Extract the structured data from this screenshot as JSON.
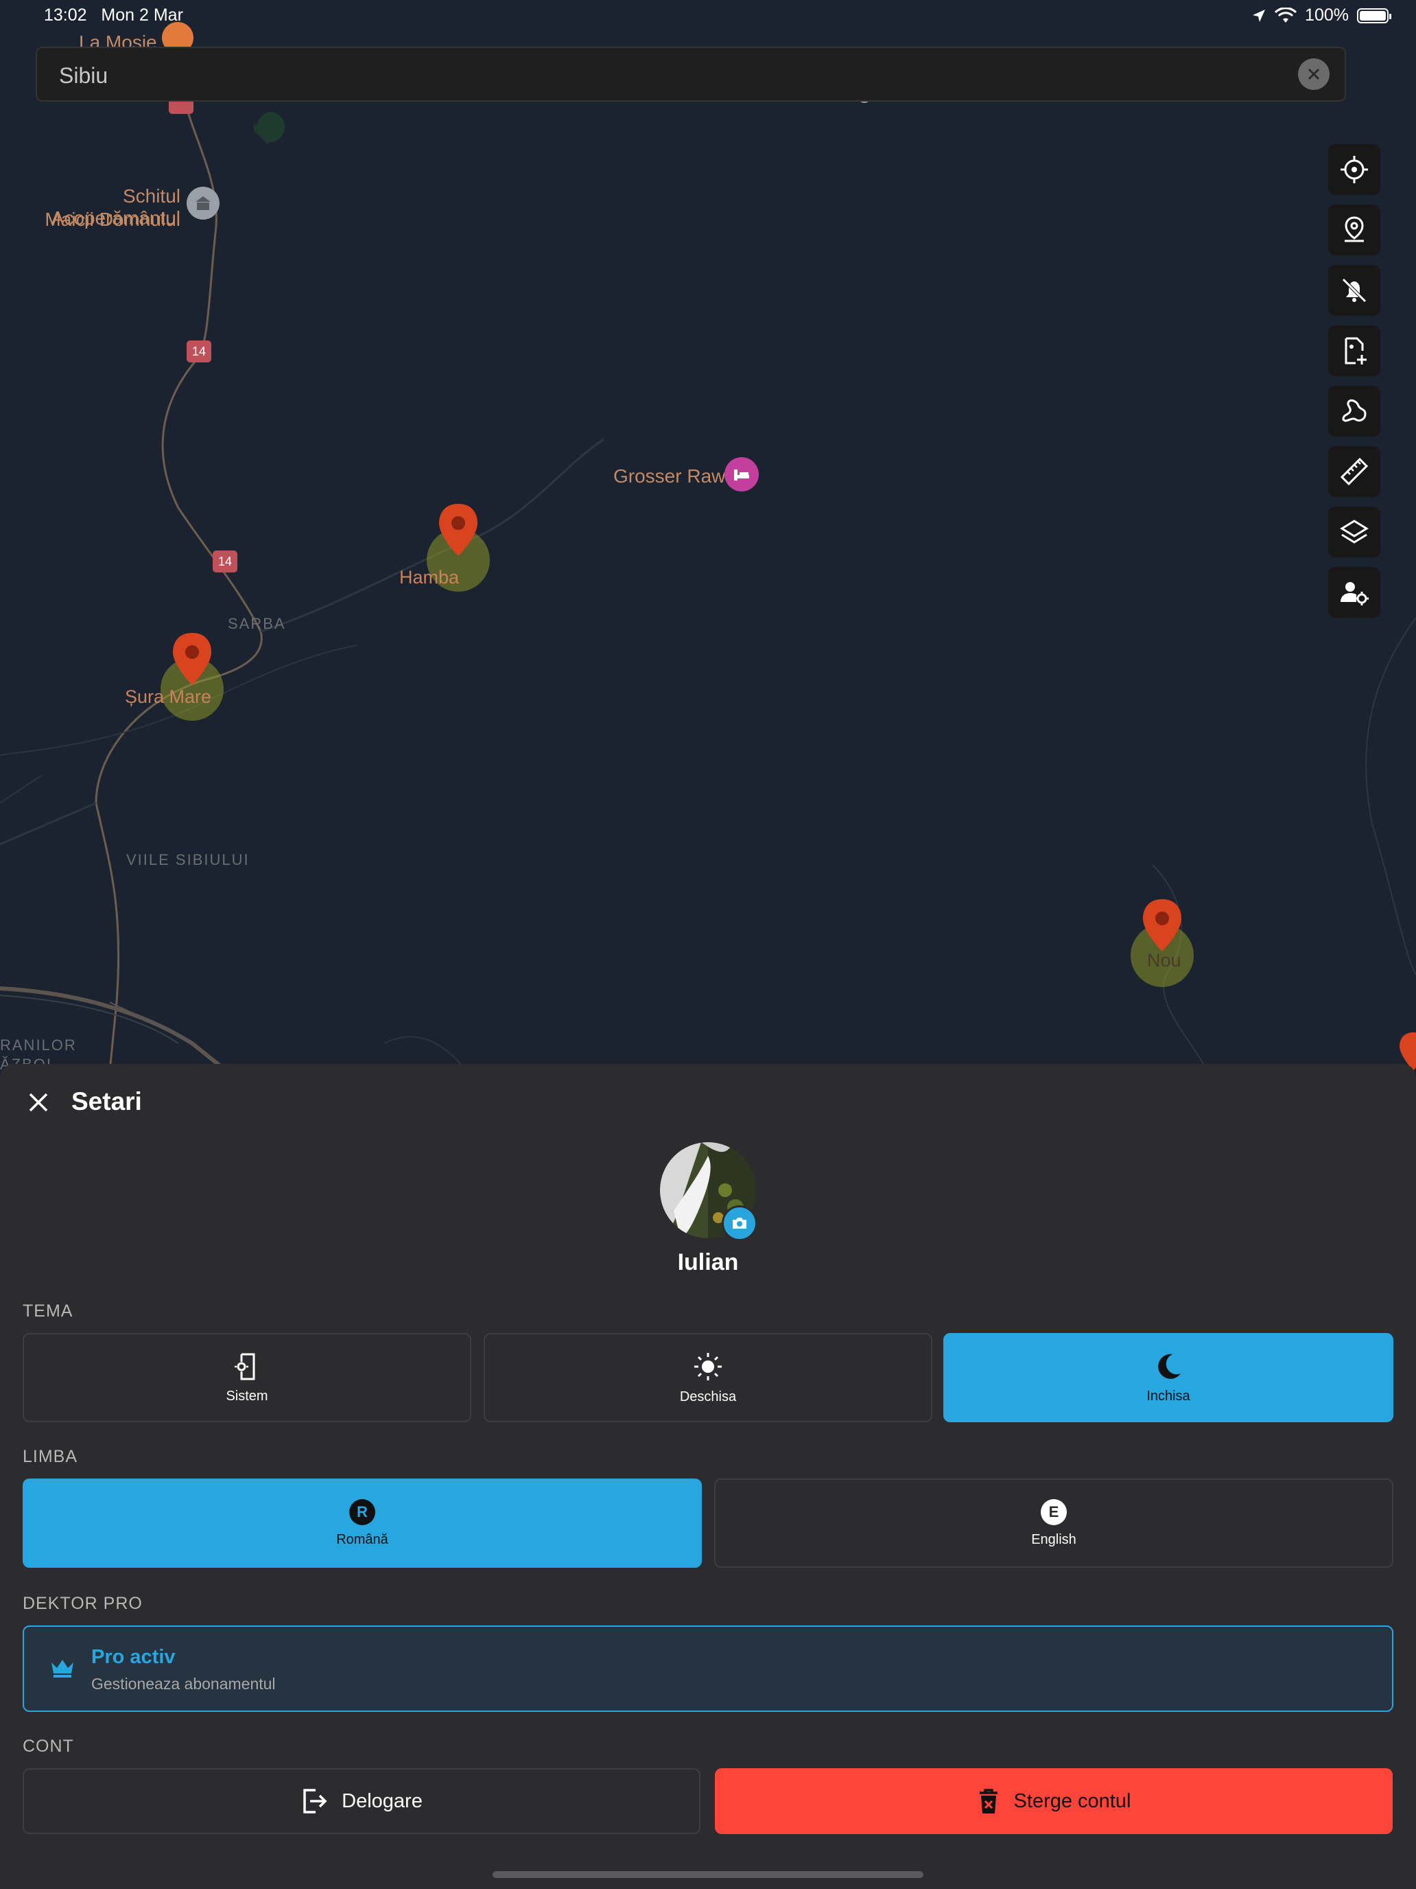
{
  "status_bar": {
    "time": "13:02",
    "date": "Mon 2 Mar",
    "battery": "100%"
  },
  "search": {
    "value": "Sibiu"
  },
  "map": {
    "labels": {
      "la_mosie": "La Moșie",
      "schit": "Schitul Acoperământul",
      "schit2": "Maicii Domnului",
      "grosser": "Grosser Raw",
      "hamba": "Hamba",
      "sura_mare": "Șura Mare",
      "nou": "Nou",
      "sarba": "SARBA",
      "viile": "VIILE SIBIULUI",
      "granilor": "RANILOR",
      "razboi": "ĂZBOI",
      "road14a": "14",
      "road14b": "14"
    },
    "tools": [
      "locate-icon",
      "place-pin-icon",
      "notifications-off-icon",
      "add-file-icon",
      "route-icon",
      "ruler-icon",
      "layers-icon",
      "user-settings-icon"
    ]
  },
  "settings": {
    "title": "Setari",
    "username": "Iulian",
    "theme": {
      "section": "TEMA",
      "options": [
        {
          "label": "Sistem",
          "icon": "phone-settings-icon"
        },
        {
          "label": "Deschisa",
          "icon": "sun-icon"
        },
        {
          "label": "Inchisa",
          "icon": "moon-icon"
        }
      ],
      "selected": "Inchisa"
    },
    "language": {
      "section": "LIMBA",
      "options": [
        {
          "label": "Română",
          "badge": "R"
        },
        {
          "label": "English",
          "badge": "E"
        }
      ],
      "selected": "Română"
    },
    "pro": {
      "section": "DEKTOR PRO",
      "title": "Pro activ",
      "subtitle": "Gestioneaza abonamentul"
    },
    "account": {
      "section": "CONT",
      "logout": "Delogare",
      "delete": "Sterge contul"
    },
    "colors": {
      "accent": "#28a6e0",
      "danger": "#ff453a",
      "sheet": "#2c2c2e"
    }
  }
}
